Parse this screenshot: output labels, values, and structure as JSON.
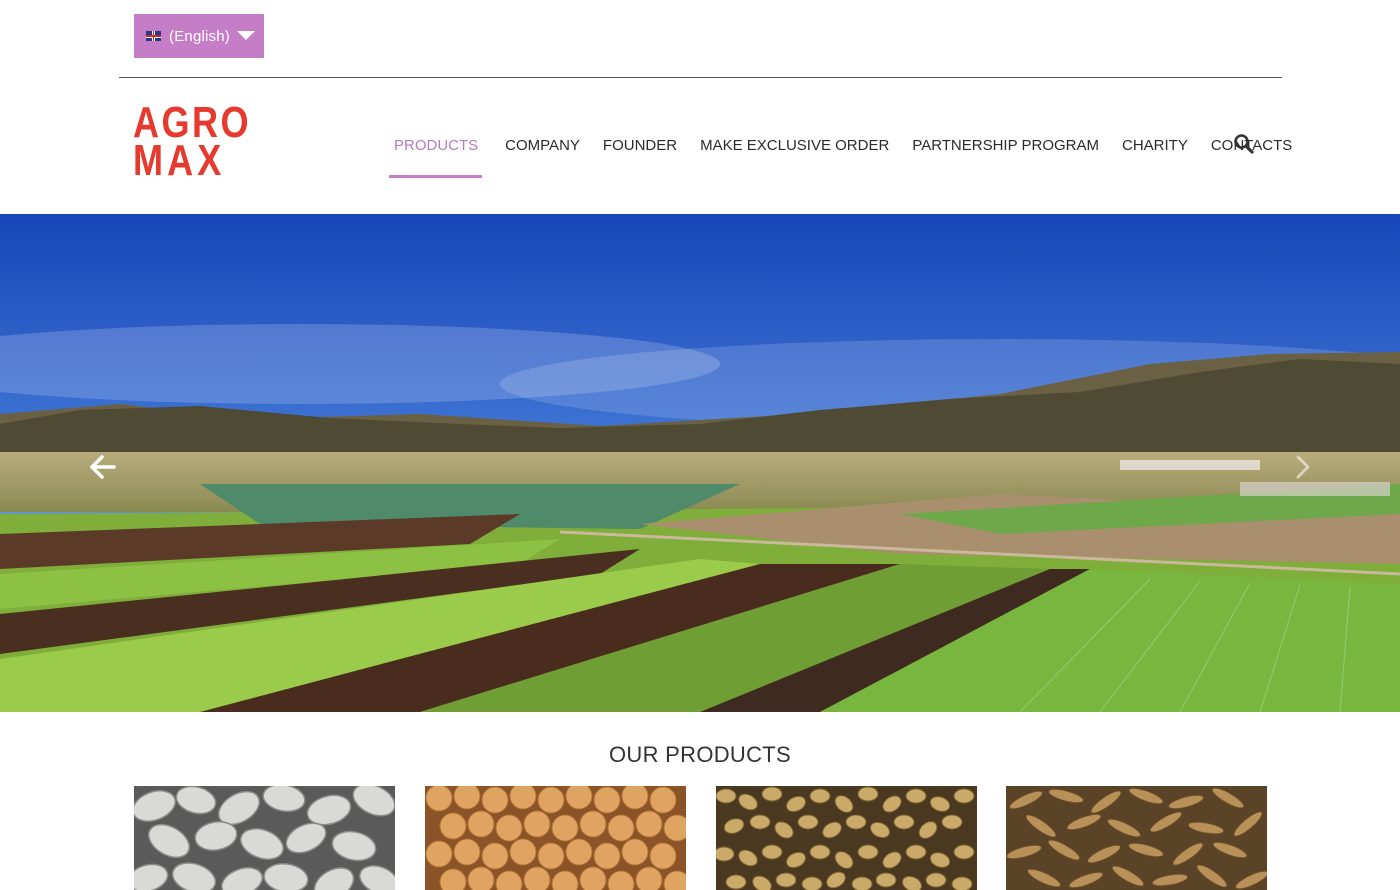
{
  "language_selector": {
    "label": "(English)",
    "flag_icon": "uk-flag-icon"
  },
  "logo": {
    "line1": "AGRO",
    "line2": "MAX",
    "color": "#e63a2e"
  },
  "nav": {
    "items": [
      {
        "label": "PRODUCTS",
        "active": true
      },
      {
        "label": "COMPANY",
        "active": false
      },
      {
        "label": "FOUNDER",
        "active": false
      },
      {
        "label": "MAKE EXCLUSIVE ORDER",
        "active": false
      },
      {
        "label": "PARTNERSHIP PROGRAM",
        "active": false
      },
      {
        "label": "CHARITY",
        "active": false
      },
      {
        "label": "CONTACTS",
        "active": false
      }
    ],
    "search_icon": "search-icon",
    "accent_color": "#c47dc6"
  },
  "hero": {
    "image": "farmland-landscape",
    "prev_icon": "arrow-left-icon",
    "next_icon": "chevron-right-icon"
  },
  "products_section": {
    "title": "OUR PRODUCTS",
    "items": [
      {
        "image": "white-beans"
      },
      {
        "image": "chickpeas"
      },
      {
        "image": "coriander-seeds"
      },
      {
        "image": "oat-grain"
      }
    ]
  }
}
